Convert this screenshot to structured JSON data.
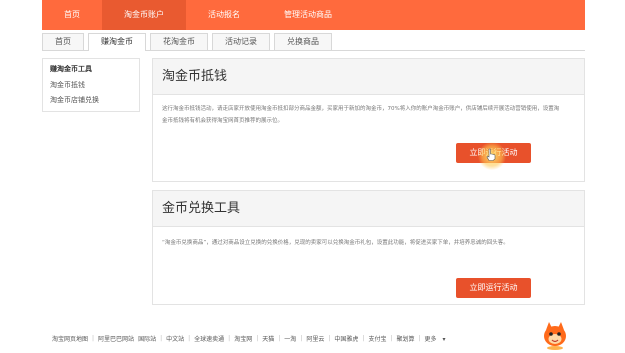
{
  "topnav": {
    "items": [
      "首页",
      "淘金币账户",
      "活动报名",
      "管理活动商品"
    ],
    "active_index": 1
  },
  "subtabs": {
    "items": [
      "首页",
      "赚淘金币",
      "花淘金币",
      "活动记录",
      "兑换商品"
    ],
    "active_index": 1
  },
  "sidebar": {
    "title": "赚淘金币工具",
    "links": [
      "淘金币抵钱",
      "淘金币店铺兑换"
    ]
  },
  "cards": [
    {
      "title": "淘金币抵钱",
      "desc": "这行淘金币抵钱活动，请走店家开放使用淘金币抵扣部分商品金额，买家用于新加的淘金币，70%将入你的账户淘金币账户，供店铺后续开展活动营销使用，设置淘金币抵钱将有机会获得淘宝网首页推荐的展示位。",
      "button": "立即运行活动"
    },
    {
      "title": "金币兑换工具",
      "desc": "“淘金币兑换商品”，通过对商品设立兑换的兑换价格，兑现的卖家可以兑换淘金币礼包，设置此功能，将促进买家下单，并培养忠诚的回头客。",
      "button": "立即运行活动"
    }
  ],
  "footer": {
    "items": [
      "淘宝网页地图",
      "阿里巴巴网站",
      "国际站",
      "中文站",
      "全球速卖通",
      "淘宝网",
      "天猫",
      "一淘",
      "阿里云",
      "中国雅虎",
      "支付宝",
      "聚划算",
      "更多"
    ]
  },
  "colors": {
    "nav_bg": "#ff6a3d",
    "nav_active": "#e95a30",
    "button_bg": "#e8512b",
    "card_head_bg": "#f5f5f5"
  },
  "icons": {
    "cursor": "hand-pointer-icon",
    "mascot": "mascot-icon",
    "more": "chevron-down-icon"
  }
}
